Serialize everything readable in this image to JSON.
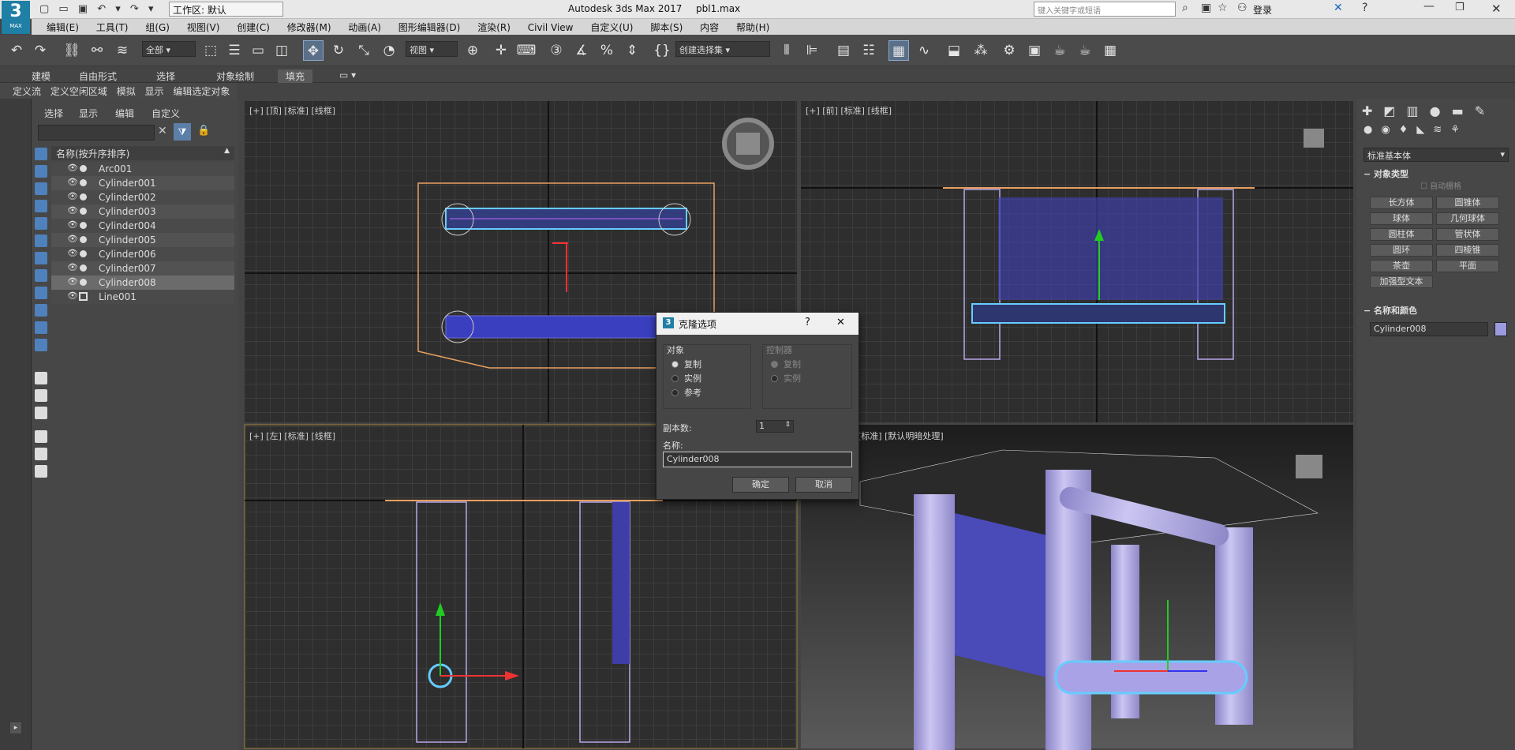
{
  "titlebar": {
    "workspace": "工作区: 默认",
    "app_title": "Autodesk 3ds Max 2017",
    "file": "pbl1.max",
    "search_placeholder": "键入关键字或短语",
    "login": "登录",
    "logo": "3",
    "logo_sub": "MAX"
  },
  "menu": [
    "编辑(E)",
    "工具(T)",
    "组(G)",
    "视图(V)",
    "创建(C)",
    "修改器(M)",
    "动画(A)",
    "图形编辑器(D)",
    "渲染(R)",
    "Civil View",
    "自定义(U)",
    "脚本(S)",
    "内容",
    "帮助(H)"
  ],
  "toolbar": {
    "filter": "全部",
    "view": "视图",
    "selection_set": "创建选择集"
  },
  "ribbon": [
    "建模",
    "自由形式",
    "选择",
    "对象绘制",
    "填充"
  ],
  "subribbon": [
    "定义流",
    "定义空闲区域",
    "模拟",
    "显示",
    "编辑选定对象"
  ],
  "scene_explorer": {
    "tabs": [
      "选择",
      "显示",
      "编辑",
      "自定义"
    ],
    "column_header": "名称(按升序排序)",
    "items": [
      "Arc001",
      "Cylinder001",
      "Cylinder002",
      "Cylinder003",
      "Cylinder004",
      "Cylinder005",
      "Cylinder006",
      "Cylinder007",
      "Cylinder008",
      "Line001"
    ],
    "selected_index": 8
  },
  "viewports": {
    "top": "[+] [顶] [标准] [线框]",
    "front": "[+] [前] [标准] [线框]",
    "left": "[+] [左] [标准] [线框]",
    "persp": "[标准] [默认明暗处理]"
  },
  "command_panel": {
    "category": "标准基本体",
    "object_type_title": "对象类型",
    "autogrid": "自动栅格",
    "buttons": [
      "长方体",
      "圆锥体",
      "球体",
      "几何球体",
      "圆柱体",
      "管状体",
      "圆环",
      "四棱锥",
      "茶壶",
      "平面",
      "加强型文本"
    ],
    "name_color_title": "名称和颜色",
    "object_name": "Cylinder008",
    "object_color": "#9b9bdf"
  },
  "dialog": {
    "title": "克隆选项",
    "help": "?",
    "close": "✕",
    "object_group": "对象",
    "object_options": [
      "复制",
      "实例",
      "参考"
    ],
    "selected_option": 0,
    "controller_group": "控制器",
    "controller_options": [
      "复制",
      "实例"
    ],
    "copies_label": "副本数:",
    "copies_value": "1",
    "name_label": "名称:",
    "name_value": "Cylinder008",
    "ok": "确定",
    "cancel": "取消"
  }
}
